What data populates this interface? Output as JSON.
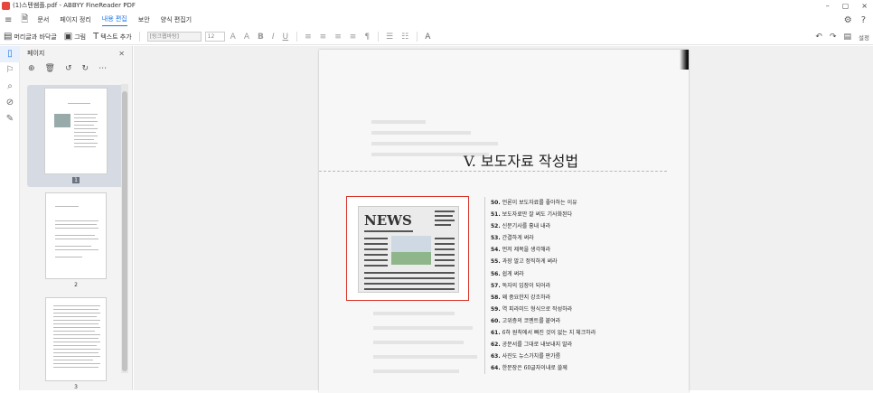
{
  "window": {
    "title": "(1)스텐쌤플.pdf - ABBYY FineReader PDF",
    "controls": [
      "–",
      "▢",
      "×"
    ]
  },
  "menu": {
    "items": [
      "문서",
      "페이지 정리",
      "내용 편집",
      "보안",
      "양식 편집기"
    ],
    "active": "내용 편집"
  },
  "toolbar": {
    "header_footer": "머리글과 바닥글",
    "picture": "그림",
    "add_text": "텍스트 추가",
    "font_placeholder": "[링크웹바탕]",
    "font_size": "12",
    "settings_label": "설정"
  },
  "panel": {
    "title": "페이지",
    "thumbs": [
      {
        "num": "1",
        "selected": true
      },
      {
        "num": "2",
        "selected": false
      },
      {
        "num": "3",
        "selected": false
      }
    ]
  },
  "document": {
    "heading": "V. 보도자료 작성법",
    "image_word": "NEWS",
    "toc": [
      {
        "n": "50.",
        "t": "언론이 보도자료를 좋아하는 이유"
      },
      {
        "n": "51.",
        "t": "보도자료만 잘 써도 기사화된다"
      },
      {
        "n": "52.",
        "t": "신문기사를 흉내 내라"
      },
      {
        "n": "53.",
        "t": "간결하게 써라"
      },
      {
        "n": "54.",
        "t": "먼저 제목을 생각해라"
      },
      {
        "n": "55.",
        "t": "과장 말고 정직하게 써라"
      },
      {
        "n": "56.",
        "t": "쉽게 써라"
      },
      {
        "n": "57.",
        "t": "독자의 입장이 되어라"
      },
      {
        "n": "58.",
        "t": "왜 중요한지 강조하라"
      },
      {
        "n": "59.",
        "t": "역 피라미드 형식으로 작성하라"
      },
      {
        "n": "60.",
        "t": "고위층의 코멘트를 붙여라"
      },
      {
        "n": "61.",
        "t": "6하 원칙에서 빠진 것이 없는 지 체크하라"
      },
      {
        "n": "62.",
        "t": "공문서를 그대로 내보내지 말라"
      },
      {
        "n": "63.",
        "t": "사진도 뉴스가치를 판가름"
      },
      {
        "n": "64.",
        "t": "한문장은 60글자이내로 쓸께"
      }
    ]
  }
}
